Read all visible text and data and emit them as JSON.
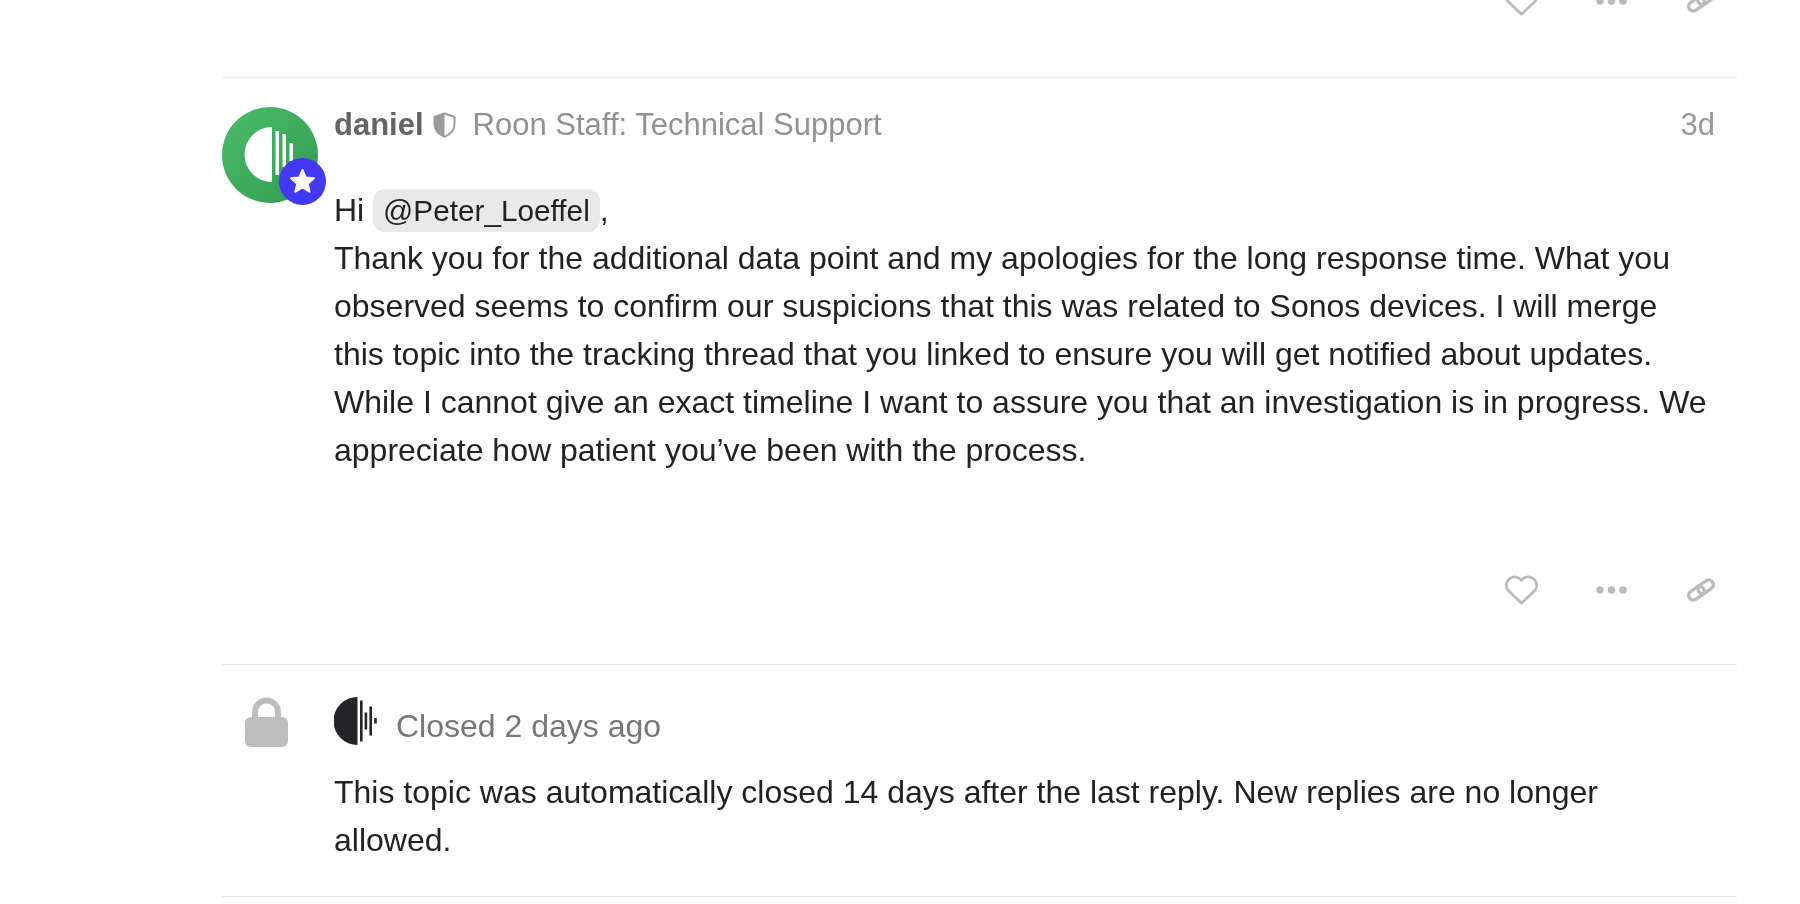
{
  "post": {
    "author": "daniel",
    "staff": true,
    "user_title": "Roon Staff: Technical Support",
    "age": "3d",
    "greeting": {
      "before": "Hi",
      "mention": "@Peter_Loeffel",
      "after": ","
    },
    "body": "Thank you for the additional data point and my apologies for the long response time. What you observed seems to confirm our suspicions that this was related to Sonos devices. I will merge this topic into the tracking thread that you linked to ensure you will get notified about updates. While I cannot give an exact timeline I want to assure you that an investigation is in progress. We appreciate how patient you’ve been with the process."
  },
  "closed_notice": {
    "status": "Closed 2 days ago",
    "message": "This topic was automatically closed 14 days after the last reply. New replies are no longer allowed."
  }
}
